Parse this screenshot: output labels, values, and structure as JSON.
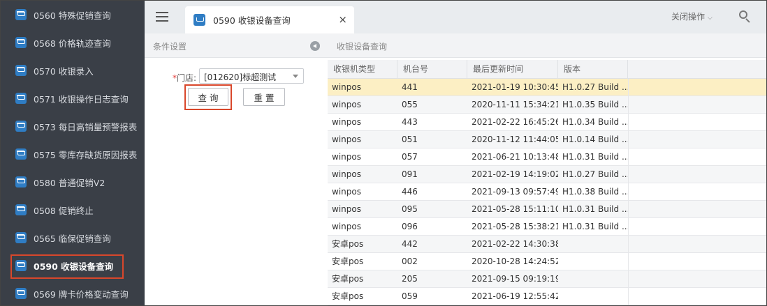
{
  "sidebar": {
    "items": [
      {
        "label": "0560 特殊促销查询",
        "icon": "cart-icon"
      },
      {
        "label": "0568 价格轨迹查询",
        "icon": "cart-icon"
      },
      {
        "label": "0570 收银录入",
        "icon": "cart-icon"
      },
      {
        "label": "0571 收银操作日志查询",
        "icon": "cart-icon"
      },
      {
        "label": "0573 每日高销量预警报表",
        "icon": "cart-icon"
      },
      {
        "label": "0575 零库存缺货原因报表",
        "icon": "cart-icon"
      },
      {
        "label": "0580 普通促销V2",
        "icon": "cart-icon"
      },
      {
        "label": "0508 促销终止",
        "icon": "cart-icon"
      },
      {
        "label": "0565 临保促销查询",
        "icon": "cart-icon"
      },
      {
        "label": "0590 收银设备查询",
        "icon": "cart-icon",
        "active": true
      },
      {
        "label": "0569 牌卡价格变动查询",
        "icon": "cart-icon"
      }
    ]
  },
  "topbar": {
    "tab_title": "0590 收银设备查询",
    "tab_close": "×",
    "close_ops_label": "关闭操作",
    "close_ops_chevron": "⌵"
  },
  "left_panel": {
    "title": "条件设置",
    "store_label_required": "*",
    "store_label": "门店:",
    "store_value": "[012620]标超测试",
    "query_button": "查询",
    "reset_button": "重置"
  },
  "right_panel": {
    "title": "收银设备查询"
  },
  "table": {
    "columns": [
      "收银机类型",
      "机台号",
      "最后更新时间",
      "版本"
    ],
    "rows": [
      [
        "winpos",
        "441",
        "2021-01-19 10:30:45",
        "H1.0.27 Build ..."
      ],
      [
        "winpos",
        "055",
        "2020-11-11 15:34:21",
        "H1.0.35 Build ..."
      ],
      [
        "winpos",
        "443",
        "2021-02-22 16:45:26",
        "H1.0.34 Build ..."
      ],
      [
        "winpos",
        "051",
        "2020-11-12 11:44:05",
        "H1.0.14 Build ..."
      ],
      [
        "winpos",
        "057",
        "2021-06-21 10:13:48",
        "H1.0.31 Build ..."
      ],
      [
        "winpos",
        "091",
        "2021-02-19 14:19:02",
        "H1.0.27 Build ..."
      ],
      [
        "winpos",
        "446",
        "2021-09-13 09:57:49",
        "H1.0.38 Build ..."
      ],
      [
        "winpos",
        "095",
        "2021-05-28 15:11:10",
        "H1.0.31 Build ..."
      ],
      [
        "winpos",
        "096",
        "2021-05-28 15:38:21",
        "H1.0.31 Build ..."
      ],
      [
        "安卓pos",
        "442",
        "2021-02-22 14:30:38",
        ""
      ],
      [
        "安卓pos",
        "002",
        "2020-10-28 14:24:52",
        ""
      ],
      [
        "安卓pos",
        "205",
        "2021-09-15 09:19:19",
        ""
      ],
      [
        "安卓pos",
        "059",
        "2021-06-19 12:55:42",
        ""
      ]
    ],
    "selected_row": 0
  },
  "colors": {
    "sidebar_bg": "#3a3f47",
    "accent": "#2f7dc4",
    "highlight_outline": "#d9472b",
    "selected_row": "#fcefc4"
  }
}
